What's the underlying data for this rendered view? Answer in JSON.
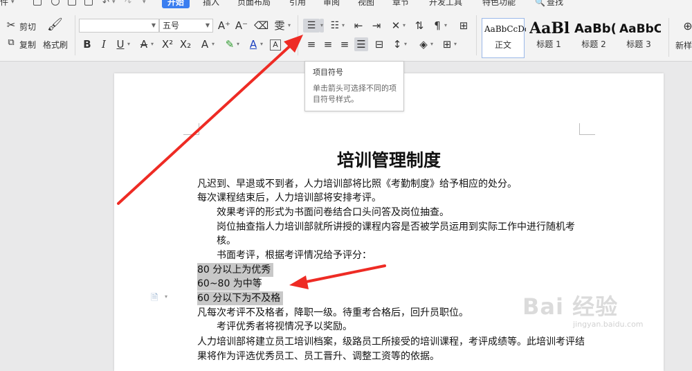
{
  "menu": {
    "items": [
      "开始",
      "插入",
      "页面布局",
      "引用",
      "审阅",
      "视图",
      "章节",
      "开发工具",
      "特色功能"
    ],
    "active_index": 0,
    "search_label": "查找",
    "leading_label": "件"
  },
  "clipboard": {
    "cut_label": "剪切",
    "copy_label": "复制",
    "format_painter_label": "格式刷"
  },
  "font": {
    "family_value": "",
    "size_value": "五号"
  },
  "styles": [
    {
      "sample": "AaBbCcDd",
      "name": "正文"
    },
    {
      "sample": "AaBl",
      "name": "标题 1"
    },
    {
      "sample": "AaBb(",
      "name": "标题 2"
    },
    {
      "sample": "AaBbC",
      "name": "标题 3"
    },
    {
      "sample": "",
      "name": "新样"
    }
  ],
  "tooltip": {
    "title": "项目符号",
    "body": "单击箭头可选择不同的项目符号样式。"
  },
  "document": {
    "title": "培训管理制度",
    "lines": [
      "凡迟到、早退或不到者，人力培训部将比照《考勤制度》给予相应的处分。",
      "每次课程结束后，人力培训部将安排考评。",
      "效果考评的形式为书面问卷结合口头问答及岗位抽查。",
      "岗位抽查指人力培训部就所讲授的课程内容是否被学员运用到实际工作中进行随机考",
      "核。",
      "书面考评，根据考评情况给予评分：",
      "80 分以上为优秀",
      "60~80 为中等",
      "60 分以下为不及格",
      "凡每次考评不及格者，降职一级。待重考合格后，回升员职位。",
      "考评优秀者将视情况予以奖励。",
      "人力培训部将建立员工培训档案，级路员工所接受的培训课程，考评成绩等。此培训考评结",
      "果将作为评选优秀员工、员工晋升、调整工资等的依据。"
    ]
  },
  "watermark": {
    "main": "Bai 经验",
    "sub": "jingyan.baidu.com"
  },
  "colors": {
    "accent": "#3a7ef0",
    "annotation_arrow": "#ee2b24",
    "selection": "#c8c8c8"
  }
}
